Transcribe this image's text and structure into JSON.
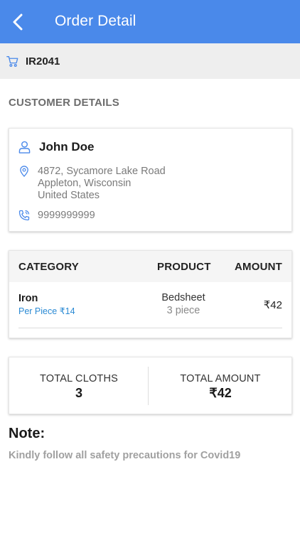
{
  "header": {
    "title": "Order Detail",
    "back_icon": "chevron-left-icon",
    "color": "#4a89ea"
  },
  "order": {
    "id": "IR2041",
    "icon": "cart-icon"
  },
  "customer_section": {
    "title": "CUSTOMER DETAILS",
    "name": "John Doe",
    "address_line1": "4872, Sycamore Lake Road",
    "address_line2": "Appleton, Wisconsin",
    "address_line3": "United States",
    "phone": "9999999999"
  },
  "items": {
    "headers": {
      "category": "CATEGORY",
      "product": "PRODUCT",
      "amount": "AMOUNT"
    },
    "rows": [
      {
        "category": "Iron",
        "rate": "Per Piece ₹14",
        "product": "Bedsheet",
        "quantity": "3 piece",
        "amount": "₹42"
      }
    ]
  },
  "totals": {
    "cloths_label": "TOTAL CLOTHS",
    "cloths_value": "3",
    "amount_label": "TOTAL AMOUNT",
    "amount_value": "₹42"
  },
  "note": {
    "title": "Note:",
    "text": "Kindly follow all safety precautions for Covid19"
  }
}
